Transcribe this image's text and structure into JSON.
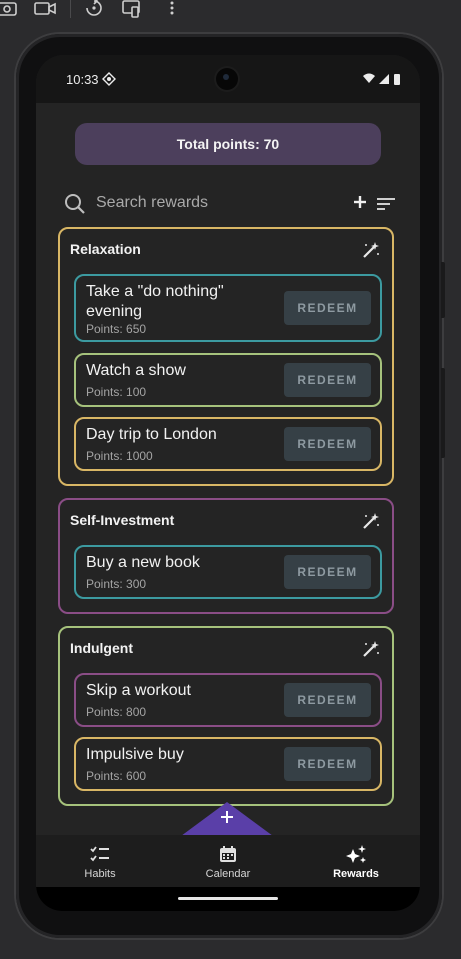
{
  "toolbar": {
    "icons": [
      "camera-icon",
      "video-icon",
      "rotate-icon",
      "screenshot-icon",
      "more-icon"
    ]
  },
  "status": {
    "time": "10:33"
  },
  "header": {
    "total_points": "Total points: 70"
  },
  "search": {
    "placeholder": "Search rewards"
  },
  "categories": [
    {
      "title": "Relaxation",
      "border": "#d8b665",
      "rewards": [
        {
          "name": "Take a \"do nothing\" evening",
          "points": "Points: 650",
          "border": "#3c9aa0"
        },
        {
          "name": "Watch a show",
          "points": "Points: 100",
          "border": "#a6c27c"
        },
        {
          "name": "Day trip to London",
          "points": "Points: 1000",
          "border": "#d8b665"
        }
      ]
    },
    {
      "title": "Self-Investment",
      "border": "#8a4d86",
      "rewards": [
        {
          "name": "Buy a new book",
          "points": "Points: 300",
          "border": "#3c9aa0"
        }
      ]
    },
    {
      "title": "Indulgent",
      "border": "#a6c27c",
      "rewards": [
        {
          "name": "Skip a workout",
          "points": "Points: 800",
          "border": "#8a4d86"
        },
        {
          "name": "Impulsive buy",
          "points": "Points: 600",
          "border": "#d8b665"
        }
      ]
    }
  ],
  "redeem_label": "REDEEM",
  "nav": [
    {
      "label": "Habits",
      "icon": "checklist-icon"
    },
    {
      "label": "Calendar",
      "icon": "calendar-icon"
    },
    {
      "label": "Rewards",
      "icon": "sparkle-icon",
      "active": true
    }
  ],
  "colors": {
    "banner": "#4c3f5c",
    "fab": "#5a3fa8",
    "redeem_bg": "#364046"
  }
}
